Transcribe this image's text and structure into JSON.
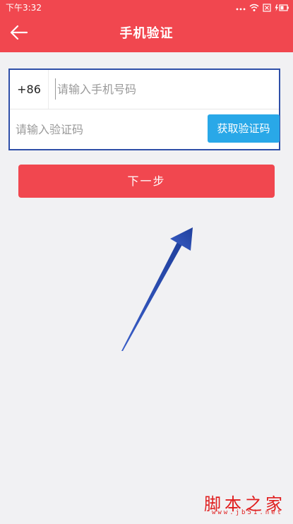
{
  "status_bar": {
    "time": "下午3:32",
    "icons": [
      "signal-dots-icon",
      "wifi-icon",
      "sim-icon",
      "battery-charging-icon"
    ]
  },
  "header": {
    "title": "手机验证",
    "back_icon": "arrow-left-icon"
  },
  "form": {
    "country_code": "+86",
    "phone_placeholder": "请输入手机号码",
    "phone_value": "",
    "code_placeholder": "请输入验证码",
    "code_value": "",
    "get_code_label": "获取验证码"
  },
  "next_button": {
    "label": "下一步"
  },
  "watermark": {
    "text": "脚本之家",
    "url": "www.jb51.net"
  },
  "colors": {
    "brand_red": "#f1474f",
    "get_code_blue": "#29a8e8",
    "highlight_border": "#2f4fa8",
    "background": "#f1f1f3"
  }
}
